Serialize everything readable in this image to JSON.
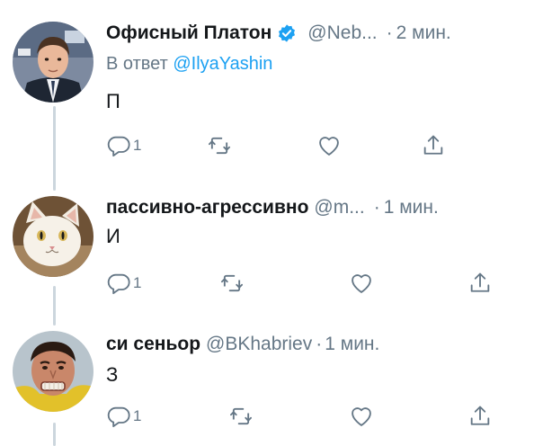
{
  "tweets": [
    {
      "author_name": "Офисный Платон",
      "verified": true,
      "handle": "@Neb...",
      "separator": "·",
      "time": "2 мин.",
      "reply_prefix": "В ответ",
      "reply_mention": "@IlyaYashin",
      "text": "П",
      "reply_count": "1",
      "avatar_icon": "man-in-suit-avatar"
    },
    {
      "author_name": "пассивно-агрессивно",
      "verified": false,
      "handle": "@m...",
      "separator": "·",
      "time": "1 мин.",
      "text": "И",
      "reply_count": "1",
      "avatar_icon": "white-cat-avatar"
    },
    {
      "author_name": "си сеньор",
      "verified": false,
      "handle": "@BKhabriev",
      "separator": "·",
      "time": "1 мин.",
      "text": "З",
      "reply_count": "1",
      "avatar_icon": "grimacing-man-avatar"
    }
  ],
  "colors": {
    "text": "#14171a",
    "secondary": "#657786",
    "link": "#1da1f2",
    "thread_line": "#ccd6dd"
  }
}
